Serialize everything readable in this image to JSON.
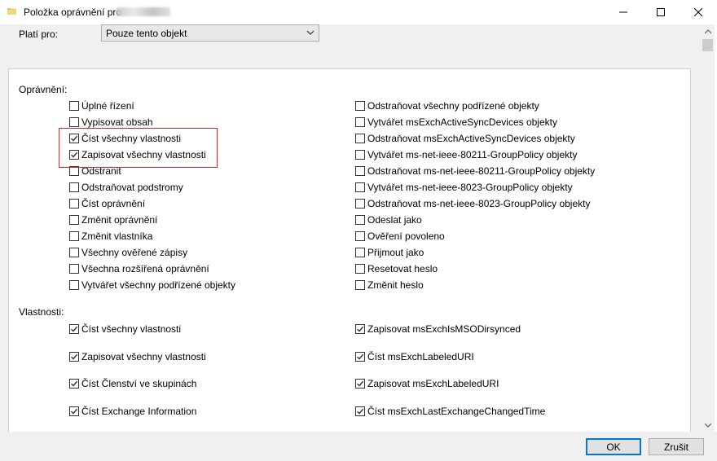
{
  "window": {
    "title": "Položka oprávnění pro"
  },
  "applies_to": {
    "label": "Platí pro:",
    "value": "Pouze tento objekt"
  },
  "permissions": {
    "label": "Oprávnění:",
    "left": [
      {
        "label": "Úplné řízení",
        "checked": false
      },
      {
        "label": "Vypisovat obsah",
        "checked": false
      },
      {
        "label": "Číst všechny vlastnosti",
        "checked": true
      },
      {
        "label": "Zapisovat všechny vlastnosti",
        "checked": true
      },
      {
        "label": "Odstranit",
        "checked": false
      },
      {
        "label": "Odstraňovat podstromy",
        "checked": false
      },
      {
        "label": "Číst oprávnění",
        "checked": false
      },
      {
        "label": "Změnit oprávnění",
        "checked": false
      },
      {
        "label": "Změnit vlastníka",
        "checked": false
      },
      {
        "label": "Všechny ověřené zápisy",
        "checked": false
      },
      {
        "label": "Všechna rozšířená oprávnění",
        "checked": false
      },
      {
        "label": "Vytvářet všechny podřízené objekty",
        "checked": false
      }
    ],
    "right": [
      {
        "label": "Odstraňovat všechny podřízené objekty",
        "checked": false
      },
      {
        "label": "Vytvářet msExchActiveSyncDevices objekty",
        "checked": false
      },
      {
        "label": "Odstraňovat msExchActiveSyncDevices objekty",
        "checked": false
      },
      {
        "label": "Vytvářet ms-net-ieee-80211-GroupPolicy objekty",
        "checked": false
      },
      {
        "label": "Odstraňovat ms-net-ieee-80211-GroupPolicy objekty",
        "checked": false
      },
      {
        "label": "Vytvářet ms-net-ieee-8023-GroupPolicy objekty",
        "checked": false
      },
      {
        "label": "Odstraňovat ms-net-ieee-8023-GroupPolicy objekty",
        "checked": false
      },
      {
        "label": "Odeslat jako",
        "checked": false
      },
      {
        "label": "Ověření povoleno",
        "checked": false
      },
      {
        "label": "Přijmout jako",
        "checked": false
      },
      {
        "label": "Resetovat heslo",
        "checked": false
      },
      {
        "label": "Změnit heslo",
        "checked": false
      }
    ]
  },
  "properties": {
    "label": "Vlastnosti:",
    "left": [
      {
        "label": "Číst všechny vlastnosti",
        "checked": true
      },
      {
        "label": "Zapisovat všechny vlastnosti",
        "checked": true
      },
      {
        "label": "Číst Členství ve skupinách",
        "checked": true
      },
      {
        "label": "Číst Exchange Information",
        "checked": true
      }
    ],
    "right": [
      {
        "label": "Zapisovat msExchIsMSODirsynced",
        "checked": true
      },
      {
        "label": "Číst msExchLabeledURI",
        "checked": true
      },
      {
        "label": "Zapisovat msExchLabeledURI",
        "checked": true
      },
      {
        "label": "Číst msExchLastExchangeChangedTime",
        "checked": true
      }
    ]
  },
  "buttons": {
    "ok": "OK",
    "cancel": "Zrušit"
  },
  "colors": {
    "highlight": "#e02424",
    "accent": "#0078d7"
  }
}
